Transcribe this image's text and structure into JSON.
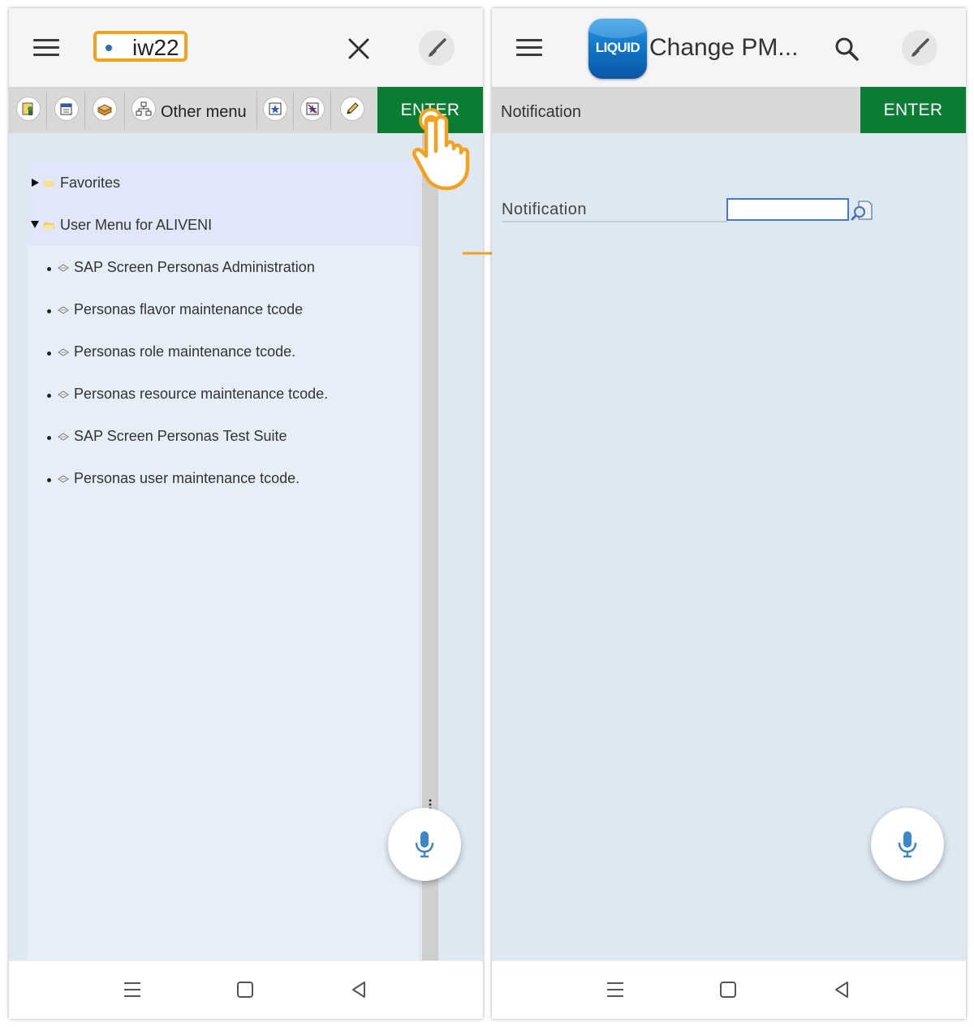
{
  "left_screen": {
    "tcode_value": "iw22",
    "toolbar": {
      "other_menu_label": "Other menu",
      "enter_label": "ENTER"
    },
    "tree": {
      "favorites": "Favorites",
      "user_menu": "User Menu for ALIVENI",
      "items": [
        "SAP Screen Personas Administration",
        "Personas flavor maintenance tcode",
        "Personas role maintenance tcode.",
        "Personas resource maintenance tcode.",
        "SAP Screen Personas Test Suite",
        "Personas user maintenance tcode."
      ]
    }
  },
  "right_screen": {
    "logo_text": "LIQUID",
    "title": "Change PM...",
    "section_title": "Notification",
    "enter_label": "ENTER",
    "field": {
      "label": "Notification",
      "value": ""
    }
  },
  "colors": {
    "accent_orange": "#f5a11c",
    "enter_green": "#0b7d33",
    "content_bg": "#dde8f0",
    "input_border": "#3c7bd8"
  },
  "icons": {
    "menu": "hamburger-icon",
    "close": "close-icon",
    "brush": "brush-icon",
    "search": "search-icon",
    "mic": "microphone-icon",
    "tap": "tap-hand-icon",
    "flow": "arrow-right-icon"
  }
}
